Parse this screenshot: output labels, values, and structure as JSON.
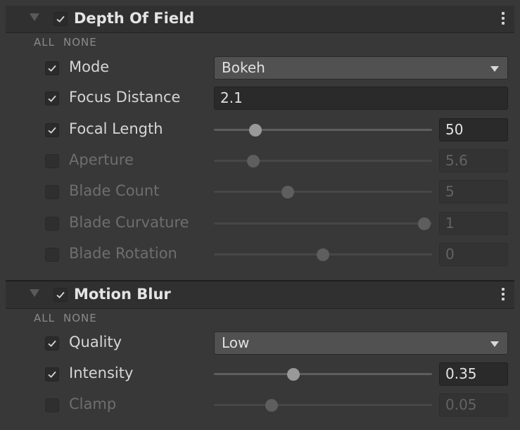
{
  "dof": {
    "title": "Depth Of Field",
    "enabled": true,
    "all_label": "ALL",
    "none_label": "NONE",
    "mode": {
      "label": "Mode",
      "value": "Bokeh",
      "enabled": true
    },
    "focus_distance": {
      "label": "Focus Distance",
      "value": "2.1",
      "enabled": true
    },
    "focal_length": {
      "label": "Focal Length",
      "value": "50",
      "enabled": true,
      "slider_fraction": 0.19
    },
    "aperture": {
      "label": "Aperture",
      "value": "5.6",
      "enabled": false,
      "slider_fraction": 0.18
    },
    "blade_count": {
      "label": "Blade Count",
      "value": "5",
      "enabled": false,
      "slider_fraction": 0.34
    },
    "blade_curvature": {
      "label": "Blade Curvature",
      "value": "1",
      "enabled": false,
      "slider_fraction": 0.965
    },
    "blade_rotation": {
      "label": "Blade Rotation",
      "value": "0",
      "enabled": false,
      "slider_fraction": 0.5
    }
  },
  "motion_blur": {
    "title": "Motion Blur",
    "enabled": true,
    "all_label": "ALL",
    "none_label": "NONE",
    "quality": {
      "label": "Quality",
      "value": "Low",
      "enabled": true
    },
    "intensity": {
      "label": "Intensity",
      "value": "0.35",
      "enabled": true,
      "slider_fraction": 0.365
    },
    "clamp": {
      "label": "Clamp",
      "value": "0.05",
      "enabled": false,
      "slider_fraction": 0.265
    }
  },
  "icons": {
    "foldout": "triangle-down-icon",
    "check": "checkmark-icon",
    "menu": "kebab-menu-icon",
    "dropdown": "chevron-down-icon"
  }
}
